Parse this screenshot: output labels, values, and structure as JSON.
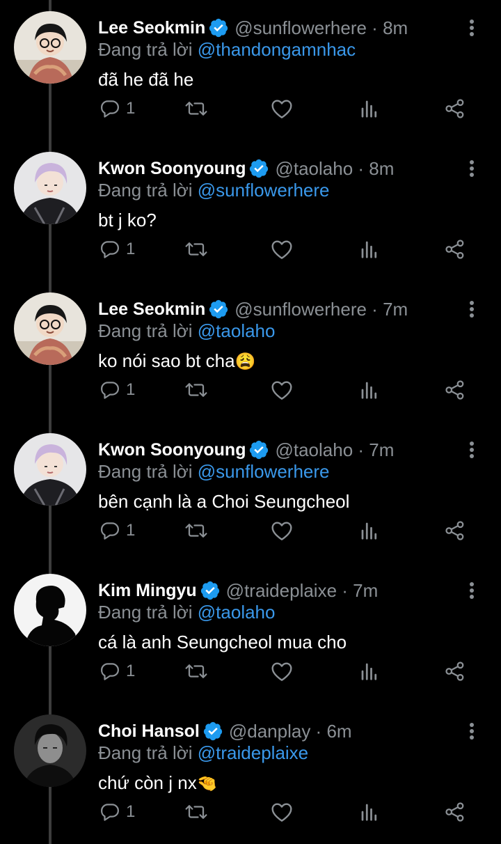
{
  "tweets": [
    {
      "name": "Lee Seokmin",
      "handle": "@sunflowerhere",
      "time": "8m",
      "replying_prefix": "Đang trả lời ",
      "replying_to": "@thandongamnhac",
      "text": "đã he đã he",
      "emoji": "",
      "reply_count": "1",
      "avatar": "lee-seokmin"
    },
    {
      "name": "Kwon Soonyoung",
      "handle": "@taolaho",
      "time": "8m",
      "replying_prefix": "Đang trả lời ",
      "replying_to": "@sunflowerhere",
      "text": "bt j ko?",
      "emoji": "",
      "reply_count": "1",
      "avatar": "kwon-soonyoung"
    },
    {
      "name": "Lee Seokmin",
      "handle": "@sunflowerhere",
      "time": "7m",
      "replying_prefix": "Đang trả lời ",
      "replying_to": "@taolaho",
      "text": "ko nói sao bt cha",
      "emoji": "😩",
      "reply_count": "1",
      "avatar": "lee-seokmin"
    },
    {
      "name": "Kwon Soonyoung",
      "handle": "@taolaho",
      "time": "7m",
      "replying_prefix": "Đang trả lời ",
      "replying_to": "@sunflowerhere",
      "text": "bên cạnh là a Choi Seungcheol",
      "emoji": "",
      "reply_count": "1",
      "avatar": "kwon-soonyoung"
    },
    {
      "name": "Kim Mingyu",
      "handle": "@traideplaixe",
      "time": "7m",
      "replying_prefix": "Đang trả lời ",
      "replying_to": "@taolaho",
      "text": "cá là anh Seungcheol mua cho",
      "emoji": "",
      "reply_count": "1",
      "avatar": "kim-mingyu"
    },
    {
      "name": "Choi Hansol",
      "handle": "@danplay",
      "time": "6m",
      "replying_prefix": "Đang trả lời ",
      "replying_to": "@traideplaixe",
      "text": "chứ còn j nx",
      "emoji": "🤏",
      "reply_count": "1",
      "avatar": "choi-hansol"
    }
  ],
  "separator": " · ",
  "colors": {
    "background": "#000000",
    "text": "#ffffff",
    "secondary": "#8b9095",
    "link": "#3a98ea",
    "verified": "#1d9bf0",
    "thread_line": "#3d3d3d"
  },
  "icons": {
    "reply": "reply-icon",
    "retweet": "retweet-icon",
    "like": "heart-icon",
    "views": "analytics-icon",
    "share": "share-icon",
    "more": "more-options-icon",
    "verified": "verified-badge-icon"
  }
}
